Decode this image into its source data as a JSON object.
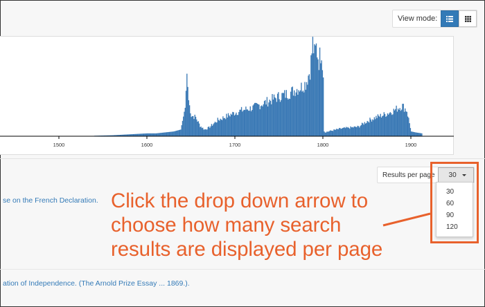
{
  "view_mode": {
    "label": "View mode:",
    "buttons": [
      {
        "name": "list-view",
        "icon": "list-icon",
        "active": true
      },
      {
        "name": "grid-view",
        "icon": "grid-icon",
        "active": false
      }
    ]
  },
  "timeline": {
    "x_ticks": [
      "1500",
      "1600",
      "1700",
      "1800",
      "1900"
    ]
  },
  "chart_data": {
    "type": "bar",
    "xlabel": "",
    "ylabel": "",
    "x_range": [
      1435,
      1950
    ],
    "x_ticks": [
      1500,
      1600,
      1700,
      1800,
      1900
    ],
    "ylim": [
      0,
      1
    ],
    "color": "#3a79b5",
    "series": [
      {
        "x": [
          1540,
          1560,
          1580,
          1600,
          1610,
          1620,
          1630,
          1638,
          1643,
          1645,
          1647,
          1650,
          1655,
          1660,
          1665,
          1670,
          1680,
          1690,
          1700,
          1710,
          1720,
          1730,
          1740,
          1750,
          1760,
          1770,
          1775,
          1780,
          1785,
          1788,
          1790,
          1792,
          1795,
          1798,
          1800,
          1801,
          1810,
          1820,
          1830,
          1840,
          1850,
          1860,
          1870,
          1875,
          1880,
          1885,
          1890,
          1895,
          1900,
          1905,
          1912
        ],
        "values": [
          0.005,
          0.01,
          0.02,
          0.03,
          0.03,
          0.04,
          0.05,
          0.07,
          0.3,
          0.66,
          0.38,
          0.22,
          0.2,
          0.11,
          0.07,
          0.09,
          0.17,
          0.21,
          0.25,
          0.28,
          0.3,
          0.34,
          0.38,
          0.42,
          0.45,
          0.5,
          0.52,
          0.56,
          0.7,
          0.98,
          0.86,
          0.94,
          0.8,
          0.92,
          0.62,
          0.04,
          0.06,
          0.08,
          0.09,
          0.1,
          0.16,
          0.2,
          0.23,
          0.25,
          0.27,
          0.3,
          0.32,
          0.27,
          0.05,
          0.04,
          0.03
        ]
      }
    ]
  },
  "results_per_page": {
    "label": "Results per page",
    "selected": "30",
    "options": [
      "30",
      "60",
      "90",
      "120"
    ]
  },
  "callout": {
    "lines": [
      "Click the drop down arrow to",
      "choose how many search",
      "results are displayed per page"
    ],
    "color": "#e8612c"
  },
  "results": [
    {
      "title_fragment": "se on the French Declaration."
    },
    {
      "title_fragment": "ation of Independence. (The Arnold Prize Essay ... 1869.)."
    }
  ]
}
